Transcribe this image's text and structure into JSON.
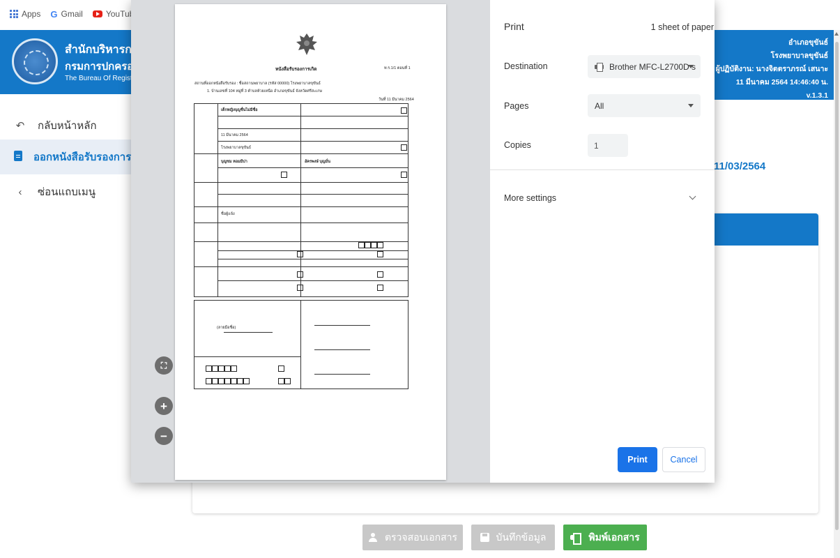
{
  "bookmarks": [
    {
      "label": "Apps",
      "icon": "apps-grid-icon"
    },
    {
      "label": "Gmail",
      "icon": "google-icon"
    },
    {
      "label": "YouTube",
      "icon": "youtube-icon"
    }
  ],
  "brand": {
    "line1": "สำนักบริหารการ",
    "line2": "กรมการปกครอง",
    "line3": "The Bureau Of Regist"
  },
  "sidebar": {
    "items": [
      {
        "label": "กลับหน้าหลัก",
        "icon": "undo-arrow-icon"
      },
      {
        "label": "ออกหนังสือรับรองการเกิด",
        "icon": "document-icon"
      },
      {
        "label": "ซ่อนแถบเมนู",
        "icon": "chevron-left-icon"
      }
    ]
  },
  "header_right": {
    "line1": "อำเภอขุขันธ์",
    "line2": "โรงพยาบาลขุขันธ์",
    "line3": "ผู้ปฏิบัติงาน: นางจิตตราภรณ์ เสนาะ",
    "line4": "11 มีนาคม 2564 14:46:40 น.  v.1.3.1"
  },
  "main": {
    "date": "11/03/2564"
  },
  "bottom_buttons": {
    "check": "ตรวจสอบเอกสาร",
    "save": "บันทึกข้อมูล",
    "print": "พิมพ์เอกสาร"
  },
  "print_dialog": {
    "title": "Print",
    "sheets": "1 sheet of paper",
    "destination_label": "Destination",
    "destination_value": "Brother MFC-L2700D s",
    "pages_label": "Pages",
    "pages_value": "All",
    "copies_label": "Copies",
    "copies_value": "1",
    "more_settings": "More settings",
    "print_button": "Print",
    "cancel_button": "Cancel"
  },
  "preview_controls": {
    "fit": "⛶",
    "zoom_in": "+",
    "zoom_out": "−"
  },
  "document": {
    "title": "หนังสือรับรองการเกิด",
    "code": "ท.ร.1/1 ตอนที่ 1",
    "place_line": "สถานที่ออกหนังสือรับรอง : ชื่อสถานพยาบาล (รหัส 00000) โรงพยาบาลขุขันธ์",
    "address_line": "1. บ้านเลขที่  104 หมู่ที่ 3 ตำบลห้วยเหนือ อำเภอขุขันธ์ จังหวัดศรีสะเกษ",
    "date_issue": "วันที่ 11 มีนาคม 2564",
    "child_name": "เด็กหญิงบุญชื่นไม่มีชื่อ",
    "birth_date": "11 มีนาคม 2564",
    "hospital": "โรงพยาบาลขุขันธ์",
    "mother_name": "บุญชม หอมมีปา",
    "father_name": "อัครพงษ์ บุญมั่น",
    "informant": "ชื่อผู้แจ้ง",
    "signature": "(ลายมือชื่อ)"
  }
}
